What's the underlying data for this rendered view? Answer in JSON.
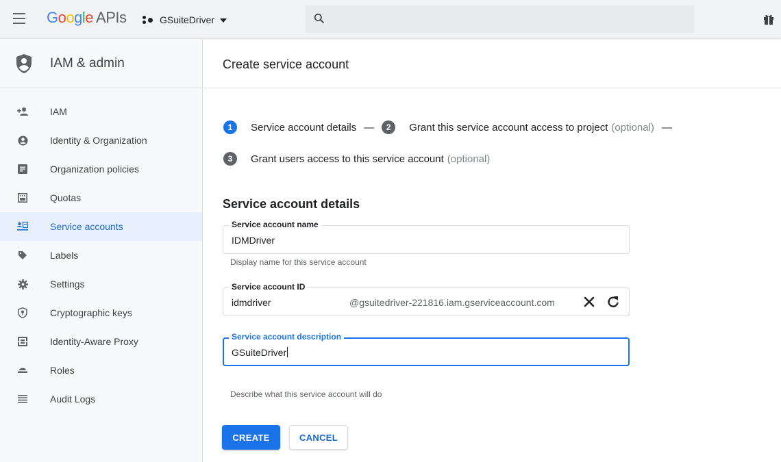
{
  "topbar": {
    "logo_google": "Google",
    "logo_apis": "APIs",
    "project_name": "GSuiteDriver",
    "search_placeholder": ""
  },
  "sidebar": {
    "title": "IAM & admin",
    "items": [
      {
        "label": "IAM",
        "icon": "person-add-icon",
        "active": false
      },
      {
        "label": "Identity & Organization",
        "icon": "account-circle-icon",
        "active": false
      },
      {
        "label": "Organization policies",
        "icon": "document-icon",
        "active": false
      },
      {
        "label": "Quotas",
        "icon": "quota-icon",
        "active": false
      },
      {
        "label": "Service accounts",
        "icon": "service-account-icon",
        "active": true
      },
      {
        "label": "Labels",
        "icon": "label-icon",
        "active": false
      },
      {
        "label": "Settings",
        "icon": "gear-icon",
        "active": false
      },
      {
        "label": "Cryptographic keys",
        "icon": "shield-key-icon",
        "active": false
      },
      {
        "label": "Identity-Aware Proxy",
        "icon": "proxy-icon",
        "active": false
      },
      {
        "label": "Roles",
        "icon": "roles-icon",
        "active": false
      },
      {
        "label": "Audit Logs",
        "icon": "list-icon",
        "active": false
      }
    ]
  },
  "main": {
    "title": "Create service account",
    "steps": [
      {
        "number": "1",
        "label": "Service account details",
        "optional": ""
      },
      {
        "number": "2",
        "label": "Grant this service account access to project",
        "optional": "(optional)"
      },
      {
        "number": "3",
        "label": "Grant users access to this service account",
        "optional": "(optional)"
      }
    ],
    "step_separator": "—",
    "section_title": "Service account details",
    "fields": {
      "name": {
        "label": "Service account name",
        "value": "IDMDriver",
        "hint": "Display name for this service account"
      },
      "id": {
        "label": "Service account ID",
        "value": "idmdriver",
        "suffix": "@gsuitedriver-221816.iam.gserviceaccount.com"
      },
      "description": {
        "label": "Service account description",
        "value": "GSuiteDriver",
        "hint": "Describe what this service account will do"
      }
    },
    "buttons": {
      "create": "CREATE",
      "cancel": "CANCEL"
    }
  },
  "colors": {
    "accent": "#1a73e8",
    "active_bg": "#e8f0fe",
    "active_text": "#1967d2"
  }
}
